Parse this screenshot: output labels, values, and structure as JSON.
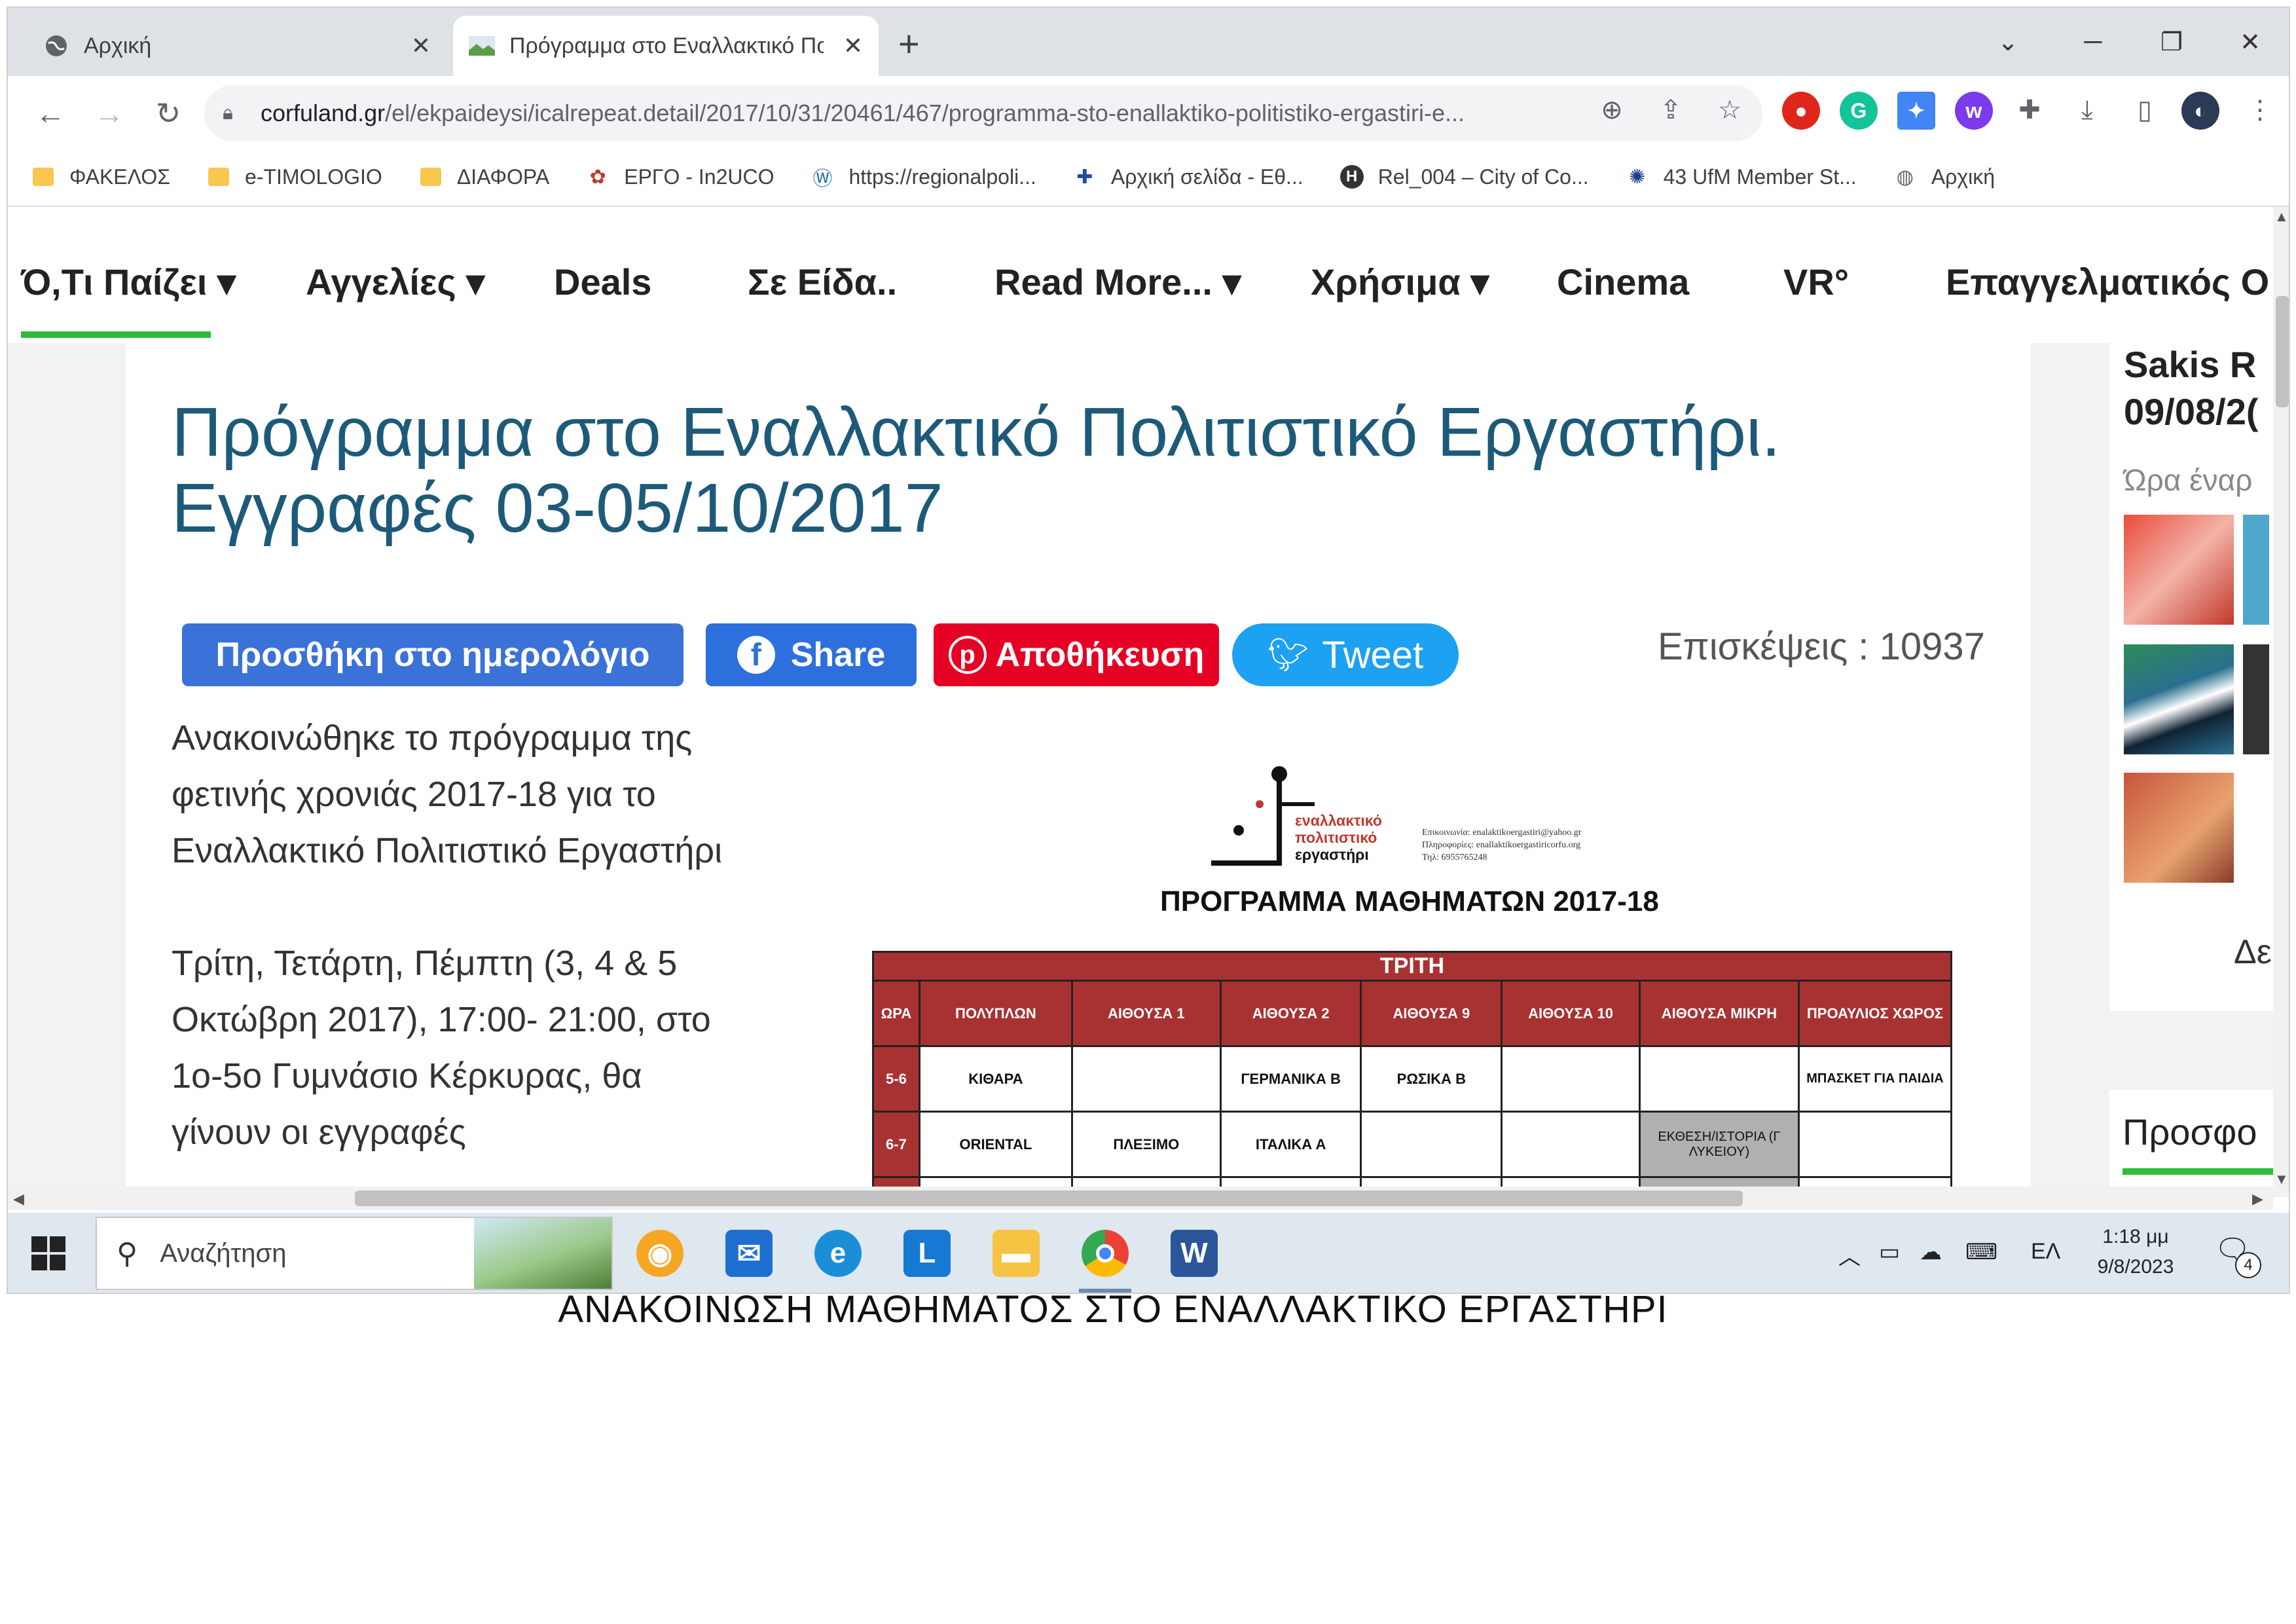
{
  "browser": {
    "tabs": [
      {
        "title": "Αρχική"
      },
      {
        "title": "Πρόγραμμα στο Εναλλακτικό Πο"
      }
    ],
    "url_host": "corfuland.gr",
    "url_path": "/el/ekpaideysi/icalrepeat.detail/2017/10/31/20461/467/programma-sto-enallaktiko-politistiko-ergastiri-e...",
    "bookmarks": [
      {
        "label": "ΦΑΚΕΛΟΣ",
        "icon": "folder-icon"
      },
      {
        "label": "e-TIMOLOGIO",
        "icon": "folder-icon"
      },
      {
        "label": "ΔΙΑΦΟΡΑ",
        "icon": "folder-icon"
      },
      {
        "label": "ΕΡΓΟ - In2UCO",
        "icon": "site-icon"
      },
      {
        "label": "https://regionalpoli...",
        "icon": "wordpress-icon"
      },
      {
        "label": "Αρχική σελίδα - Εθ...",
        "icon": "site-icon"
      },
      {
        "label": "Rel_004 – City of Co...",
        "icon": "h-icon"
      },
      {
        "label": "43 UfM Member St...",
        "icon": "globe-icon"
      },
      {
        "label": "Αρχική",
        "icon": "globe-icon"
      }
    ]
  },
  "site": {
    "nav": [
      {
        "label": "Ό,Τι Παίζει ▾"
      },
      {
        "label": "Αγγελίες ▾"
      },
      {
        "label": "Deals"
      },
      {
        "label": "Σε Είδα.."
      },
      {
        "label": "Read More... ▾"
      },
      {
        "label": "Χρήσιμα ▾"
      },
      {
        "label": "Cinema"
      },
      {
        "label": "VR°"
      },
      {
        "label": "Επαγγελματικός Ο"
      }
    ],
    "title_line1": "Πρόγραμμα στο Εναλλακτικό Πολιτιστικό Εργαστήρι.",
    "title_line2": "Εγγραφές 03-05/10/2017",
    "buttons": {
      "calendar": "Προσθήκη στο ημερολόγιο",
      "share": "Share",
      "save": "Αποθήκευση",
      "tweet": "Tweet"
    },
    "visits": "Επισκέψεις : 10937",
    "para1": [
      "Ανακοινώθηκε το πρόγραμμα της",
      "φετινής χρονιάς 2017-18 για το",
      "Εναλλακτικό Πολιτιστικό Εργαστήρι"
    ],
    "para2": [
      "Τρίτη, Τετάρτη, Πέμπτη (3, 4 & 5",
      "Οκτώβρη 2017), 17:00- 21:00, στο",
      "1ο-5ο Γυμνάσιο Κέρκυρας, θα",
      "γίνουν οι εγγραφές"
    ],
    "poster": {
      "logo_lines": [
        "εναλλακτικό",
        "πολιτιστικό",
        "εργαστήρι"
      ],
      "contact_lines": [
        "Επικοινωνία: enalaktikoergastiri@yahoo.gr",
        "Πληροφορίες: enallaktikoergastiricorfu.org",
        "Τηλ: 6955765248"
      ],
      "title": "ΠΡΟΓΡΑΜΜΑ ΜΑΘΗΜΑΤΩΝ 2017-18",
      "day": "ΤΡΙΤΗ",
      "headers": [
        "ΩΡΑ",
        "ΠΟΛΥΠΛΩΝ",
        "ΑΙΘΟΥΣΑ 1",
        "ΑΙΘΟΥΣΑ 2",
        "ΑΙΘΟΥΣΑ 9",
        "ΑΙΘΟΥΣΑ 10",
        "ΑΙΘΟΥΣΑ ΜΙΚΡΗ",
        "ΠΡΟΑΥΛΙΟΣ ΧΩΡΟΣ"
      ],
      "rows": [
        [
          "5-6",
          "ΚΙΘΑΡΑ",
          "",
          "ΓΕΡΜΑΝΙΚΑ Β",
          "ΡΩΣΙΚΑ Β",
          "",
          "",
          "ΜΠΑΣΚΕΤ ΓΙΑ ΠΑΙΔΙΑ"
        ],
        [
          "6-7",
          "ORIENTAL",
          "ΠΛΕΞΙΜΟ",
          "ΙΤΑΛΙΚΑ Α",
          "",
          "",
          "ΕΚΘΕΣΗ/ΙΣΤΟΡΙΑ (Γ ΛΥΚΕΙΟΥ)",
          ""
        ]
      ]
    },
    "sidebar": {
      "name": "Sakis R",
      "date": "09/08/2(",
      "subtitle": "Ώρα έναρ",
      "more": "Δε",
      "offers": "Προσφο"
    }
  },
  "taskbar": {
    "search_placeholder": "Αναζήτηση",
    "lang": "ΕΛ",
    "time": "1:18 μμ",
    "date": "9/8/2023",
    "notifications": "4"
  },
  "caption": "ΑΝΑΚΟΙΝΩΣΗ ΜΑΘΗΜΑΤΟΣ ΣΤΟ ΕΝΑΛΛΑΚΤΙΚΟ ΕΡΓΑΣΤΗΡΙ"
}
